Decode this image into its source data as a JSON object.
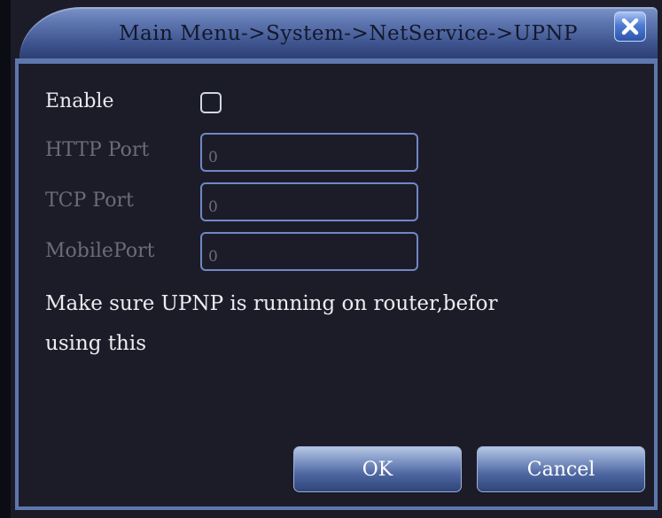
{
  "dialog": {
    "title": "Main Menu->System->NetService->UPNP",
    "close_icon": "close-icon"
  },
  "form": {
    "enable_label": "Enable",
    "enable_checked": false,
    "http_port_label": "HTTP Port",
    "http_port_value": "0",
    "tcp_port_label": "TCP Port",
    "tcp_port_value": "0",
    "mobile_port_label": "MobilePort",
    "mobile_port_value": "0"
  },
  "notice": {
    "line1": "Make sure UPNP is running on router,befor",
    "line2": "using this"
  },
  "buttons": {
    "ok_label": "OK",
    "cancel_label": "Cancel"
  },
  "colors": {
    "background": "#1c1c29",
    "title_bar": "#5e76b0",
    "border": "#5e77ad",
    "disabled_text": "#6b6c78"
  }
}
